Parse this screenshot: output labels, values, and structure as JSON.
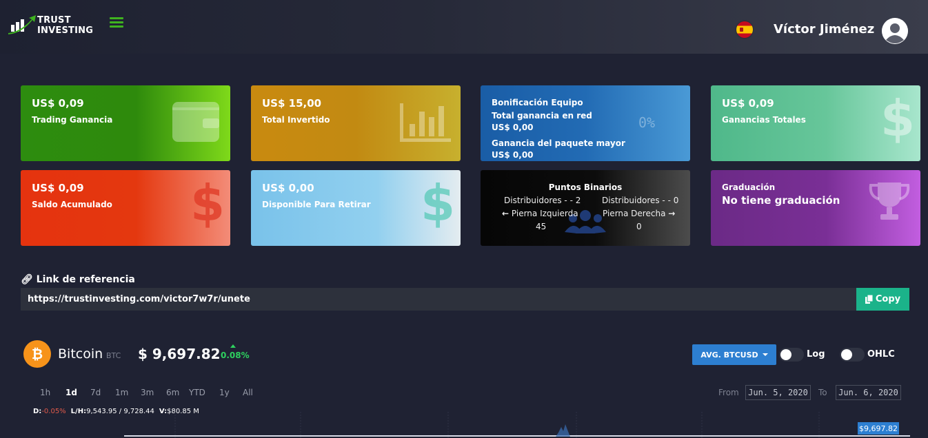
{
  "header": {
    "logo_line1": "TRUST",
    "logo_line2": "INVESTING",
    "user_name": "Víctor Jiménez"
  },
  "cards": {
    "trading": {
      "value": "US$ 0,09",
      "label": "Trading Ganancia"
    },
    "invested": {
      "value": "US$ 15,00",
      "label": "Total Invertido"
    },
    "team_bonus": {
      "title": "Bonificación Equipo",
      "network_label": "Total ganancia en red",
      "network_value": "US$ 0,00",
      "package_label": "Ganancia del paquete mayor",
      "package_value": "US$ 0,00",
      "percent": "0%"
    },
    "total_earnings": {
      "value": "US$ 0,09",
      "label": "Ganancias Totales"
    },
    "accumulated": {
      "value": "US$ 0,09",
      "label": "Saldo Acumulado"
    },
    "withdrawable": {
      "value": "US$ 0,00",
      "label": "Disponible Para Retirar"
    },
    "binary": {
      "title": "Puntos Binarios",
      "left_distributors": "Distribuidores - - 2",
      "right_distributors": "Distribuidores - - 0",
      "left_leg": "Pierna Izquierda",
      "right_leg": "Pierna Derecha",
      "left_points": "45",
      "right_points": "0"
    },
    "graduation": {
      "label": "Graduación",
      "value": "No tiene graduación"
    }
  },
  "referral": {
    "title": "Link de referencia",
    "url": "https://trustinvesting.com/victor7w7r/unete",
    "copy_label": "Copy"
  },
  "crypto": {
    "name": "Bitcoin",
    "symbol": "BTC",
    "price": "$ 9,697.82",
    "change": "0.08%",
    "pair_button": "AVG. BTCUSD",
    "log_label": "Log",
    "ohlc_label": "OHLC",
    "ranges": [
      "1h",
      "1d",
      "7d",
      "1m",
      "3m",
      "6m",
      "YTD",
      "1y",
      "All"
    ],
    "active_range": "1d",
    "from_label": "From",
    "from_date": "Jun. 5, 2020",
    "to_label": "To",
    "to_date": "Jun. 6, 2020",
    "stats_d_label": "D:",
    "stats_d_value": "-0.05%",
    "stats_lh_label": "L/H:",
    "stats_lh_value": "9,543.95 / 9,728.44",
    "stats_v_label": "V:",
    "stats_v_value": "$80.85 M",
    "price_tag": "$9,697.82"
  },
  "colors": {
    "background": "#1f2233",
    "accent_green": "#3fb31f",
    "copy_button": "#1bb38a",
    "pair_button": "#2d7fd1",
    "btc_orange": "#f7931a"
  }
}
